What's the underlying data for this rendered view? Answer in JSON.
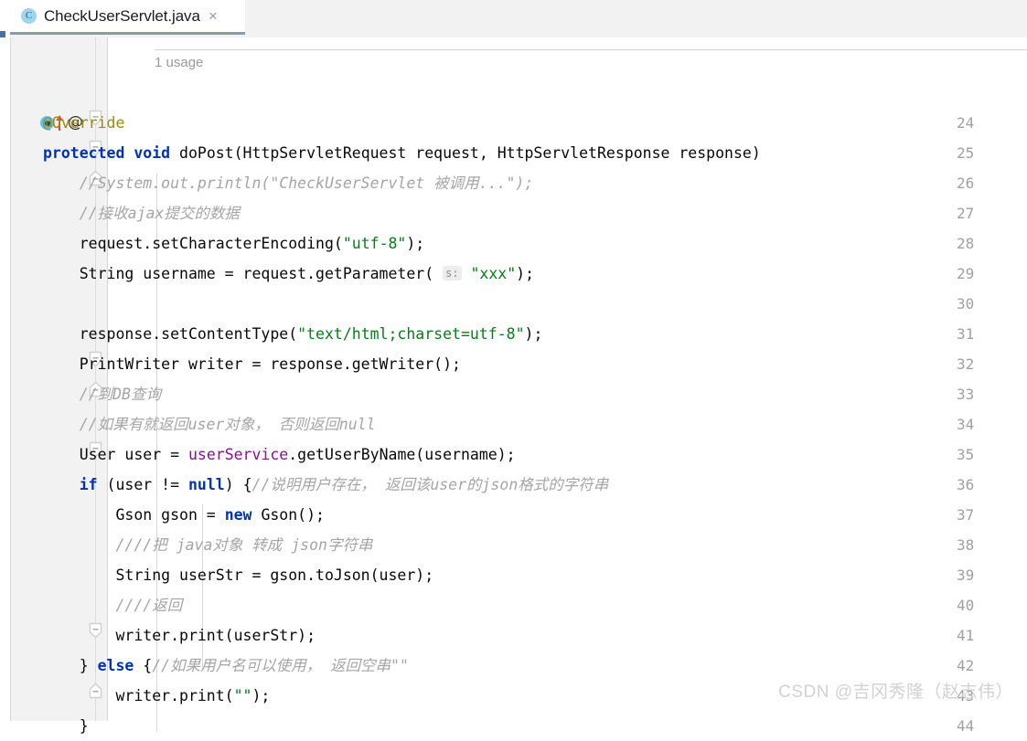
{
  "window": {
    "app": "IntelliJ IDEA Editor"
  },
  "tabbar": {
    "tabs": [
      {
        "icon": "java-class-icon",
        "icon_glyph": "C",
        "label": "CheckUserServlet.java",
        "close_glyph": "×",
        "active": true
      }
    ]
  },
  "editor": {
    "usage_hint": "1 usage",
    "first_line_number": 24,
    "gutter_markers": {
      "line_25": [
        "method-implements-icon",
        "override-arrow-icon",
        "annotation-at-icon"
      ]
    },
    "fold_markers": [
      {
        "line": 25,
        "direction": "down"
      },
      {
        "line": 26,
        "direction": "down"
      },
      {
        "line": 27,
        "direction": "up"
      },
      {
        "line": 33,
        "direction": "down"
      },
      {
        "line": 34,
        "direction": "up"
      },
      {
        "line": 36,
        "direction": "down"
      },
      {
        "line": 42,
        "direction": "down"
      },
      {
        "line": 44,
        "direction": "up"
      }
    ],
    "param_hint": "s:",
    "lines": [
      {
        "n": 24,
        "tokens": [
          {
            "t": "@Override",
            "c": "anno"
          }
        ]
      },
      {
        "n": 25,
        "tokens": [
          {
            "t": "protected ",
            "c": "kw"
          },
          {
            "t": "void ",
            "c": "kw"
          },
          {
            "t": "doPost(HttpServletRequest request, HttpServletResponse response)",
            "c": "plain"
          }
        ]
      },
      {
        "n": 26,
        "tokens": [
          {
            "t": "    //System.out.println(\"CheckUserServlet 被调用...\");",
            "c": "cmt"
          }
        ]
      },
      {
        "n": 27,
        "tokens": [
          {
            "t": "    //接收ajax提交的数据",
            "c": "cmt"
          }
        ]
      },
      {
        "n": 28,
        "tokens": [
          {
            "t": "    request.setCharacterEncoding(",
            "c": "plain"
          },
          {
            "t": "\"utf-8\"",
            "c": "str"
          },
          {
            "t": ");",
            "c": "plain"
          }
        ]
      },
      {
        "n": 29,
        "tokens": [
          {
            "t": "    String username = request.getParameter( ",
            "c": "plain"
          },
          {
            "t": "s:",
            "c": "hint"
          },
          {
            "t": " ",
            "c": "plain"
          },
          {
            "t": "\"xxx\"",
            "c": "str"
          },
          {
            "t": ");",
            "c": "plain"
          }
        ]
      },
      {
        "n": 30,
        "tokens": []
      },
      {
        "n": 31,
        "tokens": [
          {
            "t": "    response.setContentType(",
            "c": "plain"
          },
          {
            "t": "\"text/html;charset=utf-8\"",
            "c": "str"
          },
          {
            "t": ");",
            "c": "plain"
          }
        ]
      },
      {
        "n": 32,
        "tokens": [
          {
            "t": "    PrintWriter writer = response.getWriter();",
            "c": "plain"
          }
        ]
      },
      {
        "n": 33,
        "tokens": [
          {
            "t": "    //到DB查询",
            "c": "cmt"
          }
        ]
      },
      {
        "n": 34,
        "tokens": [
          {
            "t": "    //如果有就返回user对象， 否则返回null",
            "c": "cmt"
          }
        ]
      },
      {
        "n": 35,
        "tokens": [
          {
            "t": "    User user = ",
            "c": "plain"
          },
          {
            "t": "userService",
            "c": "fld"
          },
          {
            "t": ".getUserByName(username);",
            "c": "plain"
          }
        ]
      },
      {
        "n": 36,
        "tokens": [
          {
            "t": "    if ",
            "c": "kw"
          },
          {
            "t": "(user != ",
            "c": "plain"
          },
          {
            "t": "null",
            "c": "kw"
          },
          {
            "t": ") {",
            "c": "plain"
          },
          {
            "t": "//说明用户存在， 返回该user的json格式的字符串",
            "c": "cmt"
          }
        ]
      },
      {
        "n": 37,
        "tokens": [
          {
            "t": "        Gson gson = ",
            "c": "plain"
          },
          {
            "t": "new ",
            "c": "kw"
          },
          {
            "t": "Gson();",
            "c": "plain"
          }
        ]
      },
      {
        "n": 38,
        "tokens": [
          {
            "t": "        ////把 java对象 转成 json字符串",
            "c": "cmt"
          }
        ]
      },
      {
        "n": 39,
        "tokens": [
          {
            "t": "        String userStr = gson.toJson(user);",
            "c": "plain"
          }
        ]
      },
      {
        "n": 40,
        "tokens": [
          {
            "t": "        ////返回",
            "c": "cmt"
          }
        ]
      },
      {
        "n": 41,
        "tokens": [
          {
            "t": "        writer.print(userStr);",
            "c": "plain"
          }
        ]
      },
      {
        "n": 42,
        "tokens": [
          {
            "t": "    } ",
            "c": "plain"
          },
          {
            "t": "else ",
            "c": "kw"
          },
          {
            "t": "{",
            "c": "plain"
          },
          {
            "t": "//如果用户名可以使用， 返回空串\"\"",
            "c": "cmt"
          }
        ]
      },
      {
        "n": 43,
        "tokens": [
          {
            "t": "        writer.print(",
            "c": "plain"
          },
          {
            "t": "\"\"",
            "c": "str"
          },
          {
            "t": ");",
            "c": "plain"
          }
        ]
      },
      {
        "n": 44,
        "tokens": [
          {
            "t": "    }",
            "c": "plain"
          }
        ]
      }
    ]
  },
  "watermark": {
    "text": "CSDN @吉冈秀隆（赵志伟）"
  },
  "colors": {
    "keyword": "#0033b3",
    "string": "#067d17",
    "comment": "#a5a5a5",
    "annotation": "#9e880d",
    "field": "#871094",
    "gutter_bg": "#f2f2f2",
    "tab_underline": "#8a9bb0",
    "tab_icon_bg": "#9fd4ee",
    "override_arrow": "#e2483d"
  }
}
